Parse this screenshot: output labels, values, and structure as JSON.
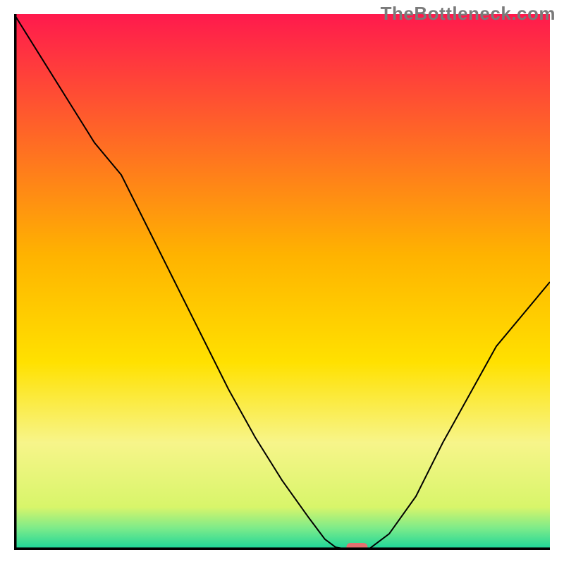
{
  "watermark": "TheBottleneck.com",
  "chart_data": {
    "type": "line",
    "title": "",
    "xlabel": "",
    "ylabel": "",
    "xlim": [
      0,
      100
    ],
    "ylim": [
      0,
      100
    ],
    "x": [
      0,
      5,
      10,
      15,
      20,
      25,
      30,
      35,
      40,
      45,
      50,
      55,
      58,
      60,
      63,
      66,
      70,
      75,
      80,
      85,
      90,
      95,
      100
    ],
    "y": [
      100,
      92,
      84,
      76,
      70,
      60,
      50,
      40,
      30,
      21,
      13,
      6,
      2,
      0.5,
      0,
      0,
      3,
      10,
      20,
      29,
      38,
      44,
      50
    ],
    "marker": {
      "x": 64,
      "y": 0
    },
    "gradient_stops": [
      {
        "offset": 0,
        "color": "#ff1a4d"
      },
      {
        "offset": 45,
        "color": "#ffb300"
      },
      {
        "offset": 65,
        "color": "#ffe100"
      },
      {
        "offset": 80,
        "color": "#f7f58a"
      },
      {
        "offset": 92,
        "color": "#d8f56a"
      },
      {
        "offset": 96,
        "color": "#7beb8a"
      },
      {
        "offset": 100,
        "color": "#17d49a"
      }
    ]
  }
}
